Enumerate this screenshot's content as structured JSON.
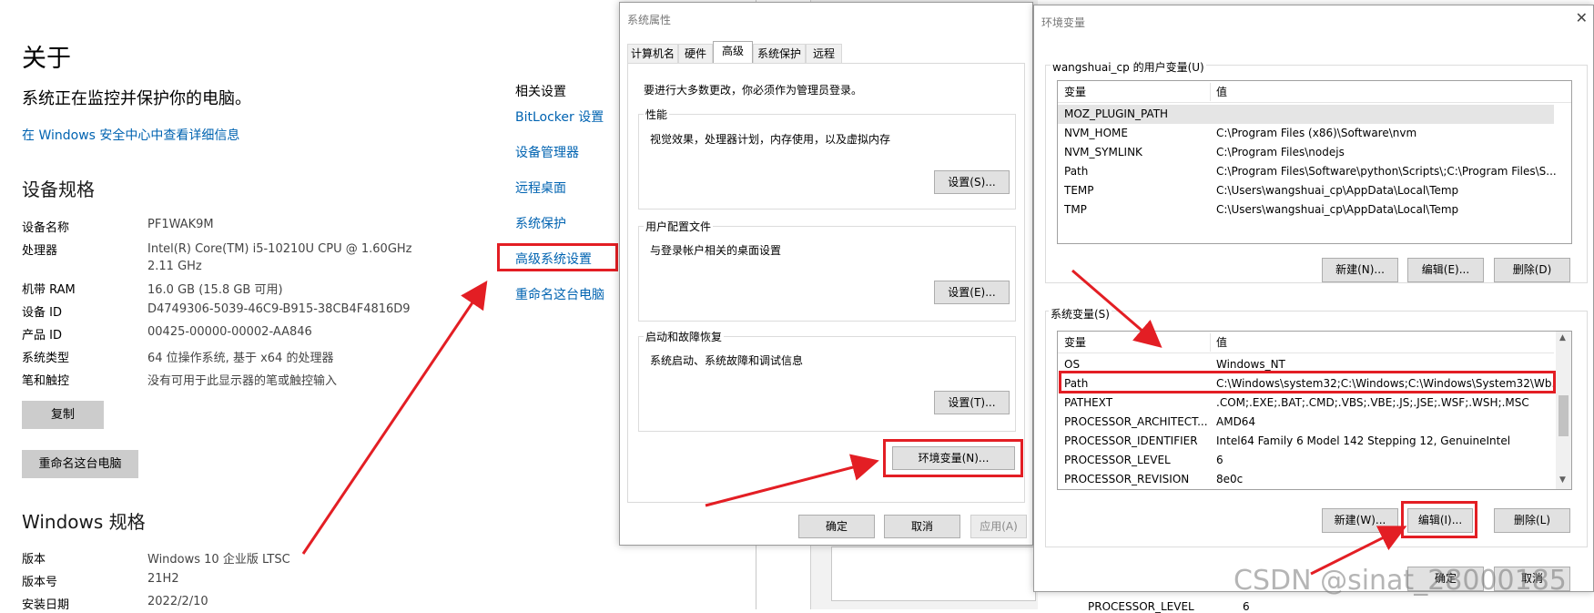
{
  "about": {
    "title": "关于",
    "protect_text": "系统正在监控并保护你的电脑。",
    "security_link": "在 Windows 安全中心中查看详细信息",
    "device_specs_heading": "设备规格",
    "specs": [
      {
        "k": "设备名称",
        "v": "PF1WAK9M"
      },
      {
        "k": "处理器",
        "v": "Intel(R) Core(TM) i5-10210U CPU @ 1.60GHz   2.11 GHz"
      },
      {
        "k": "机带 RAM",
        "v": "16.0 GB (15.8 GB 可用)"
      },
      {
        "k": "设备 ID",
        "v": "D4749306-5039-46C9-B915-38CB4F4816D9"
      },
      {
        "k": "产品 ID",
        "v": "00425-00000-00002-AA846"
      },
      {
        "k": "系统类型",
        "v": "64 位操作系统, 基于 x64 的处理器"
      },
      {
        "k": "笔和触控",
        "v": "没有可用于此显示器的笔或触控输入"
      }
    ],
    "copy_button": "复制",
    "rename_button": "重命名这台电脑",
    "windows_specs_heading": "Windows 规格",
    "win_specs": [
      {
        "k": "版本",
        "v": "Windows 10 企业版 LTSC"
      },
      {
        "k": "版本号",
        "v": "21H2"
      },
      {
        "k": "安装日期",
        "v": "2022/2/10"
      }
    ],
    "related_heading": "相关设置",
    "related_links": [
      "BitLocker 设置",
      "设备管理器",
      "远程桌面",
      "系统保护",
      "高级系统设置",
      "重命名这台电脑"
    ]
  },
  "sysprops": {
    "title": "系统属性",
    "tabs": [
      "计算机名",
      "硬件",
      "高级",
      "系统保护",
      "远程"
    ],
    "admin_note": "要进行大多数更改，你必须作为管理员登录。",
    "perf_label": "性能",
    "perf_desc": "视觉效果，处理器计划，内存使用，以及虚拟内存",
    "perf_btn": "设置(S)...",
    "profile_label": "用户配置文件",
    "profile_desc": "与登录帐户相关的桌面设置",
    "profile_btn": "设置(E)...",
    "startup_label": "启动和故障恢复",
    "startup_desc": "系统启动、系统故障和调试信息",
    "startup_btn": "设置(T)...",
    "envvar_btn": "环境变量(N)...",
    "ok": "确定",
    "cancel": "取消",
    "apply": "应用(A)"
  },
  "envvars": {
    "title": "环境变量",
    "user_group": "wangshuai_cp 的用户变量(U)",
    "col_var": "变量",
    "col_val": "值",
    "user_vars": [
      {
        "k": "MOZ_PLUGIN_PATH",
        "v": ""
      },
      {
        "k": "NVM_HOME",
        "v": "C:\\Program Files (x86)\\Software\\nvm"
      },
      {
        "k": "NVM_SYMLINK",
        "v": "C:\\Program Files\\nodejs"
      },
      {
        "k": "Path",
        "v": "C:\\Program Files\\Software\\python\\Scripts\\;C:\\Program Files\\S..."
      },
      {
        "k": "TEMP",
        "v": "C:\\Users\\wangshuai_cp\\AppData\\Local\\Temp"
      },
      {
        "k": "TMP",
        "v": "C:\\Users\\wangshuai_cp\\AppData\\Local\\Temp"
      }
    ],
    "user_new": "新建(N)...",
    "user_edit": "编辑(E)...",
    "user_delete": "删除(D)",
    "sys_group": "系统变量(S)",
    "sys_vars": [
      {
        "k": "OS",
        "v": "Windows_NT"
      },
      {
        "k": "Path",
        "v": "C:\\Windows\\system32;C:\\Windows;C:\\Windows\\System32\\Wb..."
      },
      {
        "k": "PATHEXT",
        "v": ".COM;.EXE;.BAT;.CMD;.VBS;.VBE;.JS;.JSE;.WSF;.WSH;.MSC"
      },
      {
        "k": "PROCESSOR_ARCHITECT...",
        "v": "AMD64"
      },
      {
        "k": "PROCESSOR_IDENTIFIER",
        "v": "Intel64 Family 6 Model 142 Stepping 12, GenuineIntel"
      },
      {
        "k": "PROCESSOR_LEVEL",
        "v": "6"
      },
      {
        "k": "PROCESSOR_REVISION",
        "v": "8e0c"
      }
    ],
    "sys_new": "新建(W)...",
    "sys_edit": "编辑(I)...",
    "sys_delete": "删除(L)",
    "ok": "确定",
    "cancel": "取消"
  },
  "background": {
    "peek_row_key": "PROCESSOR_LEVEL",
    "peek_row_val": "6"
  },
  "watermark": "CSDN @sinat_28000185",
  "colors": {
    "highlight": "#e31e24",
    "link": "#0063b1"
  }
}
